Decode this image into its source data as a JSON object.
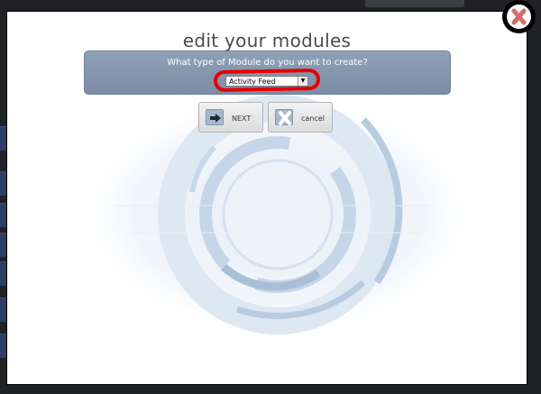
{
  "modal": {
    "title": "edit your modules",
    "prompt": "What type of Module do you want to create?",
    "module_type": {
      "selected": "Activity Feed"
    },
    "buttons": {
      "next_label": "NEXT",
      "cancel_label": "cancel"
    }
  },
  "colors": {
    "panel": "#8ea0b7",
    "highlight": "#e60000",
    "close_x": "#e07070"
  },
  "icons": {
    "next": "arrow-right-icon",
    "cancel": "x-icon",
    "close": "close-icon"
  }
}
